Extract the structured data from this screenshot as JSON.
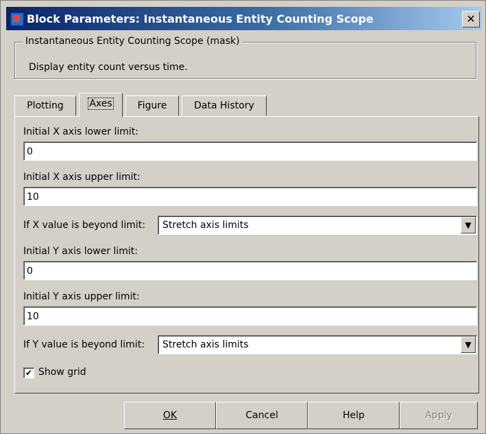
{
  "window": {
    "title": "Block Parameters: Instantaneous Entity Counting Scope",
    "close_glyph": "✕"
  },
  "mask": {
    "title": "Instantaneous Entity Counting Scope (mask)",
    "description": "Display entity count versus time."
  },
  "tabs": [
    {
      "label": "Plotting"
    },
    {
      "label": "Axes"
    },
    {
      "label": "Figure"
    },
    {
      "label": "Data History"
    }
  ],
  "active_tab": "Axes",
  "fields": {
    "x_lower": {
      "label": "Initial X axis lower limit:",
      "value": "0"
    },
    "x_upper": {
      "label": "Initial X axis upper limit:",
      "value": "10"
    },
    "x_beyond": {
      "label": "If X value is beyond limit:",
      "value": "Stretch axis limits"
    },
    "y_lower": {
      "label": "Initial Y axis lower limit:",
      "value": "0"
    },
    "y_upper": {
      "label": "Initial Y axis upper limit:",
      "value": "10"
    },
    "y_beyond": {
      "label": "If Y value is beyond limit:",
      "value": "Stretch axis limits"
    }
  },
  "show_grid": {
    "label": "Show grid",
    "checked": true,
    "check_glyph": "✔"
  },
  "dropdown_glyph": "▼",
  "buttons": {
    "ok": "OK",
    "cancel": "Cancel",
    "help": "Help",
    "apply": "Apply"
  }
}
